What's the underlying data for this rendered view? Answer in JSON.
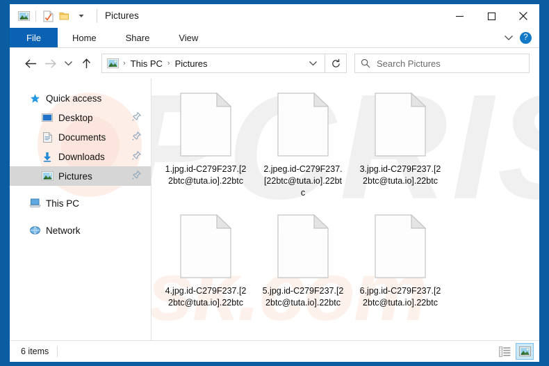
{
  "window": {
    "title": "Pictures",
    "quick_access_toolbar": [
      {
        "name": "pictures-folder-icon",
        "label": "Pictures"
      },
      {
        "name": "properties-icon",
        "label": "Properties"
      },
      {
        "name": "new-folder-icon",
        "label": "New folder"
      },
      {
        "name": "customize-dropdown-icon",
        "label": "Customize Quick Access Toolbar"
      }
    ],
    "controls": {
      "minimize": "–",
      "maximize": "☐",
      "close": "✕"
    }
  },
  "ribbon": {
    "tabs": [
      {
        "label": "File",
        "active": true
      },
      {
        "label": "Home",
        "active": false
      },
      {
        "label": "Share",
        "active": false
      },
      {
        "label": "View",
        "active": false
      }
    ],
    "collapse_icon": "chevron-down-icon",
    "help_label": "?"
  },
  "address_bar": {
    "back_label": "Back",
    "forward_label": "Forward",
    "recent_label": "Recent locations",
    "up_label": "Up",
    "breadcrumbs": [
      "This PC",
      "Pictures"
    ],
    "separator": "›",
    "dropdown_icon": "chevron-down-icon",
    "refresh_icon": "refresh-icon"
  },
  "search": {
    "placeholder": "Search Pictures",
    "icon": "search-icon"
  },
  "sidebar": {
    "items": [
      {
        "label": "Quick access",
        "icon": "star-icon",
        "level": 0,
        "selected": false,
        "pinned": false
      },
      {
        "label": "Desktop",
        "icon": "desktop-icon",
        "level": 1,
        "selected": false,
        "pinned": true
      },
      {
        "label": "Documents",
        "icon": "documents-icon",
        "level": 1,
        "selected": false,
        "pinned": true
      },
      {
        "label": "Downloads",
        "icon": "downloads-icon",
        "level": 1,
        "selected": false,
        "pinned": true
      },
      {
        "label": "Pictures",
        "icon": "pictures-icon",
        "level": 1,
        "selected": true,
        "pinned": true
      },
      {
        "label": "This PC",
        "icon": "this-pc-icon",
        "level": 0,
        "selected": false,
        "pinned": false
      },
      {
        "label": "Network",
        "icon": "network-icon",
        "level": 0,
        "selected": false,
        "pinned": false
      }
    ]
  },
  "files": [
    {
      "name": "1.jpg.id-C279F237.[22btc@tuta.io].22btc",
      "icon": "blank-document-icon"
    },
    {
      "name": "2.jpeg.id-C279F237.[22btc@tuta.io].22btc",
      "icon": "blank-document-icon"
    },
    {
      "name": "3.jpg.id-C279F237.[22btc@tuta.io].22btc",
      "icon": "blank-document-icon"
    },
    {
      "name": "4.jpg.id-C279F237.[22btc@tuta.io].22btc",
      "icon": "blank-document-icon"
    },
    {
      "name": "5.jpg.id-C279F237.[22btc@tuta.io].22btc",
      "icon": "blank-document-icon"
    },
    {
      "name": "6.jpg.id-C279F237.[22btc@tuta.io].22btc",
      "icon": "blank-document-icon"
    }
  ],
  "status_bar": {
    "item_count": "6 items",
    "views": [
      {
        "name": "details-view-icon",
        "label": "Details view",
        "active": false
      },
      {
        "name": "large-icons-view-icon",
        "label": "Large icons view",
        "active": true
      }
    ]
  },
  "watermarks": {
    "grey": "PCRISK",
    "pink": "risk.com"
  },
  "colors": {
    "frame_blue": "#0b5ca0",
    "tab_blue": "#0b62b4",
    "help_blue": "#1278c8",
    "selection_grey": "#d6d6d6",
    "view_active_blue": "#cde8f7"
  }
}
